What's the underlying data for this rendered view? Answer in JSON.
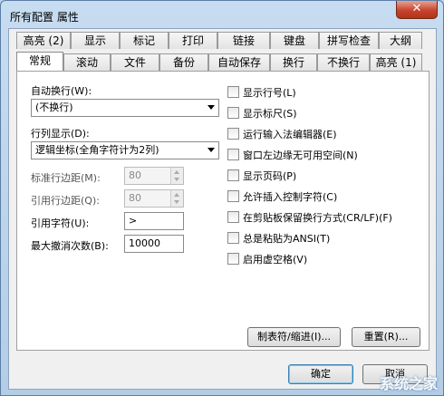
{
  "window": {
    "title": "所有配置 属性",
    "close_glyph": "✕"
  },
  "tabs_back": [
    "高亮 (2)",
    "显示",
    "标记",
    "打印",
    "链接",
    "键盘",
    "拼写检查",
    "大纲"
  ],
  "tabs_front": [
    "常规",
    "滚动",
    "文件",
    "备份",
    "自动保存",
    "换行",
    "不换行",
    "高亮 (1)"
  ],
  "active_tab": "常规",
  "left": {
    "auto_wrap_label": "自动换行(W):",
    "auto_wrap_value": "(不换行)",
    "column_display_label": "行列显示(D):",
    "column_display_value": "逻辑坐标(全角字符计为2列)",
    "std_line_margin_label": "标准行边距(M):",
    "std_line_margin_value": "80",
    "quote_line_margin_label": "引用行边距(Q):",
    "quote_line_margin_value": "80",
    "quote_char_label": "引用字符(U):",
    "quote_char_value": ">",
    "max_undo_label": "最大撤消次数(B):",
    "max_undo_value": "10000"
  },
  "checkboxes": [
    {
      "label": "显示行号(L)",
      "checked": false
    },
    {
      "label": "显示标尺(S)",
      "checked": false
    },
    {
      "label": "运行输入法编辑器(E)",
      "checked": false
    },
    {
      "label": "窗口左边缘无可用空间(N)",
      "checked": false
    },
    {
      "label": "显示页码(P)",
      "checked": false
    },
    {
      "label": "允许插入控制字符(C)",
      "checked": false
    },
    {
      "label": "在剪贴板保留换行方式(CR/LF)(F)",
      "checked": false
    },
    {
      "label": "总是粘贴为ANSI(T)",
      "checked": false
    },
    {
      "label": "启用虚空格(V)",
      "checked": false
    }
  ],
  "buttons": {
    "tabs_indent": "制表符/缩进(I)...",
    "reset": "重置(R)...",
    "ok": "确定",
    "cancel": "取消"
  },
  "watermark": "系统之家"
}
